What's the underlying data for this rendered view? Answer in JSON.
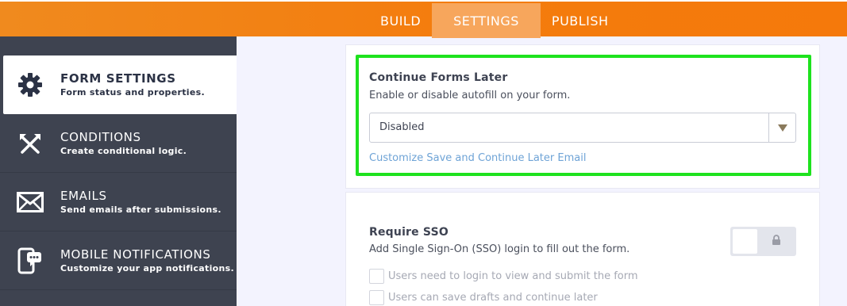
{
  "topnav": {
    "tabs": [
      {
        "label": "BUILD",
        "active": false
      },
      {
        "label": "SETTINGS",
        "active": true
      },
      {
        "label": "PUBLISH",
        "active": false
      }
    ]
  },
  "sidebar": {
    "items": [
      {
        "icon": "gear-icon",
        "title": "FORM SETTINGS",
        "subtitle": "Form status and properties.",
        "active": true
      },
      {
        "icon": "conditions-icon",
        "title": "CONDITIONS",
        "subtitle": "Create conditional logic.",
        "active": false
      },
      {
        "icon": "envelope-icon",
        "title": "EMAILS",
        "subtitle": "Send emails after submissions.",
        "active": false
      },
      {
        "icon": "mobile-notification-icon",
        "title": "MOBILE NOTIFICATIONS",
        "subtitle": "Customize your app notifications.",
        "active": false
      }
    ]
  },
  "continue_later": {
    "title": "Continue Forms Later",
    "description": "Enable or disable autofill on your form.",
    "selected": "Disabled",
    "link": "Customize Save and Continue Later Email"
  },
  "sso": {
    "title": "Require SSO",
    "description": "Add Single Sign-On (SSO) login to fill out the form.",
    "toggle_on": false,
    "options": [
      {
        "label": "Users need to login to view and submit the form",
        "checked": false
      },
      {
        "label": "Users can save drafts and continue later",
        "checked": false
      }
    ]
  },
  "colors": {
    "accent": "#f47c0d",
    "sidebar": "#3e4350",
    "highlight": "#1ee21e",
    "link": "#6ea3d6"
  }
}
